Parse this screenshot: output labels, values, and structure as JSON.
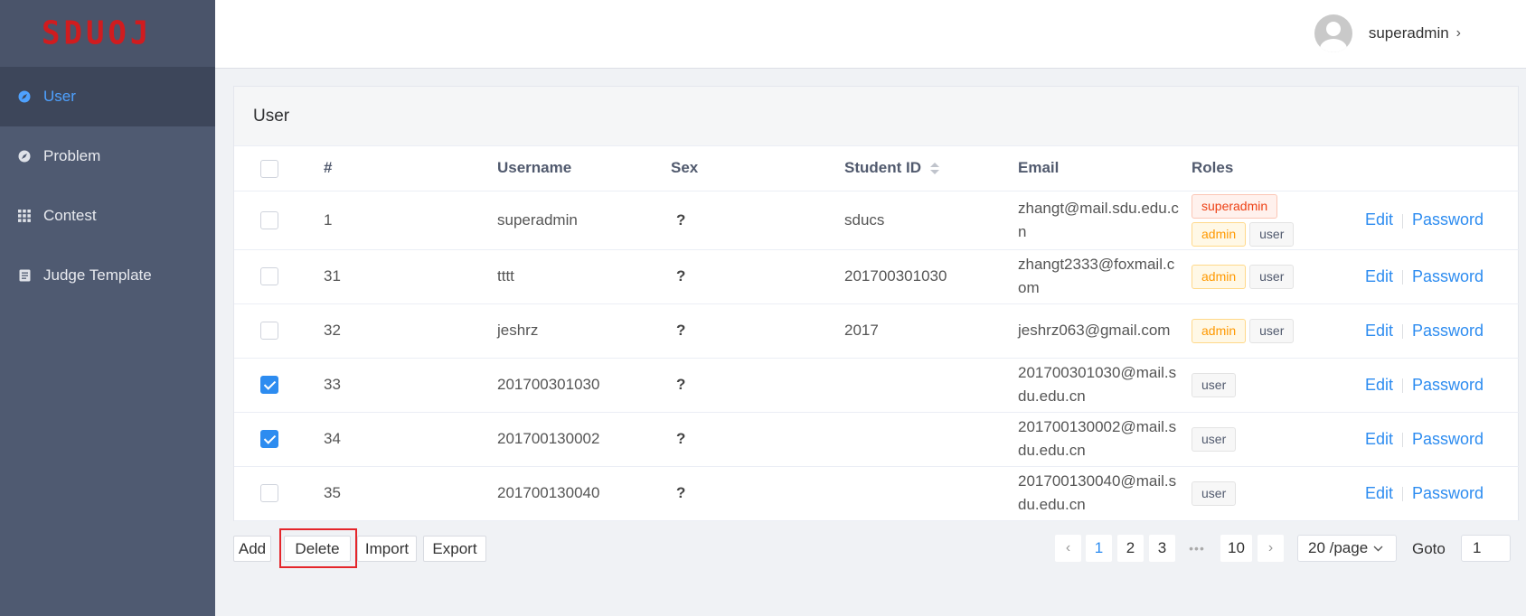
{
  "logo": "SDUOJ",
  "sidebar": {
    "items": [
      {
        "label": "User",
        "icon": "compass-icon",
        "active": true
      },
      {
        "label": "Problem",
        "icon": "compass-icon",
        "active": false
      },
      {
        "label": "Contest",
        "icon": "grid-icon",
        "active": false
      },
      {
        "label": "Judge Template",
        "icon": "document-icon",
        "active": false
      }
    ]
  },
  "header": {
    "username": "superadmin",
    "chevron": "›"
  },
  "card": {
    "title": "User"
  },
  "table": {
    "headers": {
      "index": "#",
      "username": "Username",
      "sex": "Sex",
      "student_id": "Student ID",
      "email": "Email",
      "roles": "Roles"
    },
    "rows": [
      {
        "id": "1",
        "username": "superadmin",
        "sex": "?",
        "student_id": "sducs",
        "email": "zhangt@mail.sdu.edu.cn",
        "roles": [
          "superadmin",
          "admin",
          "user"
        ],
        "checked": false
      },
      {
        "id": "31",
        "username": "tttt",
        "sex": "?",
        "student_id": "201700301030",
        "email": "zhangt2333@foxmail.com",
        "roles": [
          "admin",
          "user"
        ],
        "checked": false
      },
      {
        "id": "32",
        "username": "jeshrz",
        "sex": "?",
        "student_id": "2017",
        "email": "jeshrz063@gmail.com",
        "roles": [
          "admin",
          "user"
        ],
        "checked": false
      },
      {
        "id": "33",
        "username": "201700301030",
        "sex": "?",
        "student_id": "",
        "email": "201700301030@mail.sdu.edu.cn",
        "roles": [
          "user"
        ],
        "checked": true
      },
      {
        "id": "34",
        "username": "201700130002",
        "sex": "?",
        "student_id": "",
        "email": "201700130002@mail.sdu.edu.cn",
        "roles": [
          "user"
        ],
        "checked": true
      },
      {
        "id": "35",
        "username": "201700130040",
        "sex": "?",
        "student_id": "",
        "email": "201700130040@mail.sdu.edu.cn",
        "roles": [
          "user"
        ],
        "checked": false
      }
    ],
    "edit_label": "Edit",
    "password_label": "Password"
  },
  "toolbar": {
    "add": "Add",
    "delete": "Delete",
    "import": "Import",
    "export": "Export"
  },
  "pagination": {
    "prev": "‹",
    "next": "›",
    "pages": [
      "1",
      "2",
      "3"
    ],
    "ellipsis": "•••",
    "last": "10",
    "current": "1",
    "page_size": "20 /page",
    "goto_label": "Goto",
    "goto_value": "1"
  },
  "colors": {
    "accent": "#2d8cf0",
    "sidebar": "#4f5a71",
    "logo": "#d01c1f",
    "highlight": "#e4262b"
  }
}
